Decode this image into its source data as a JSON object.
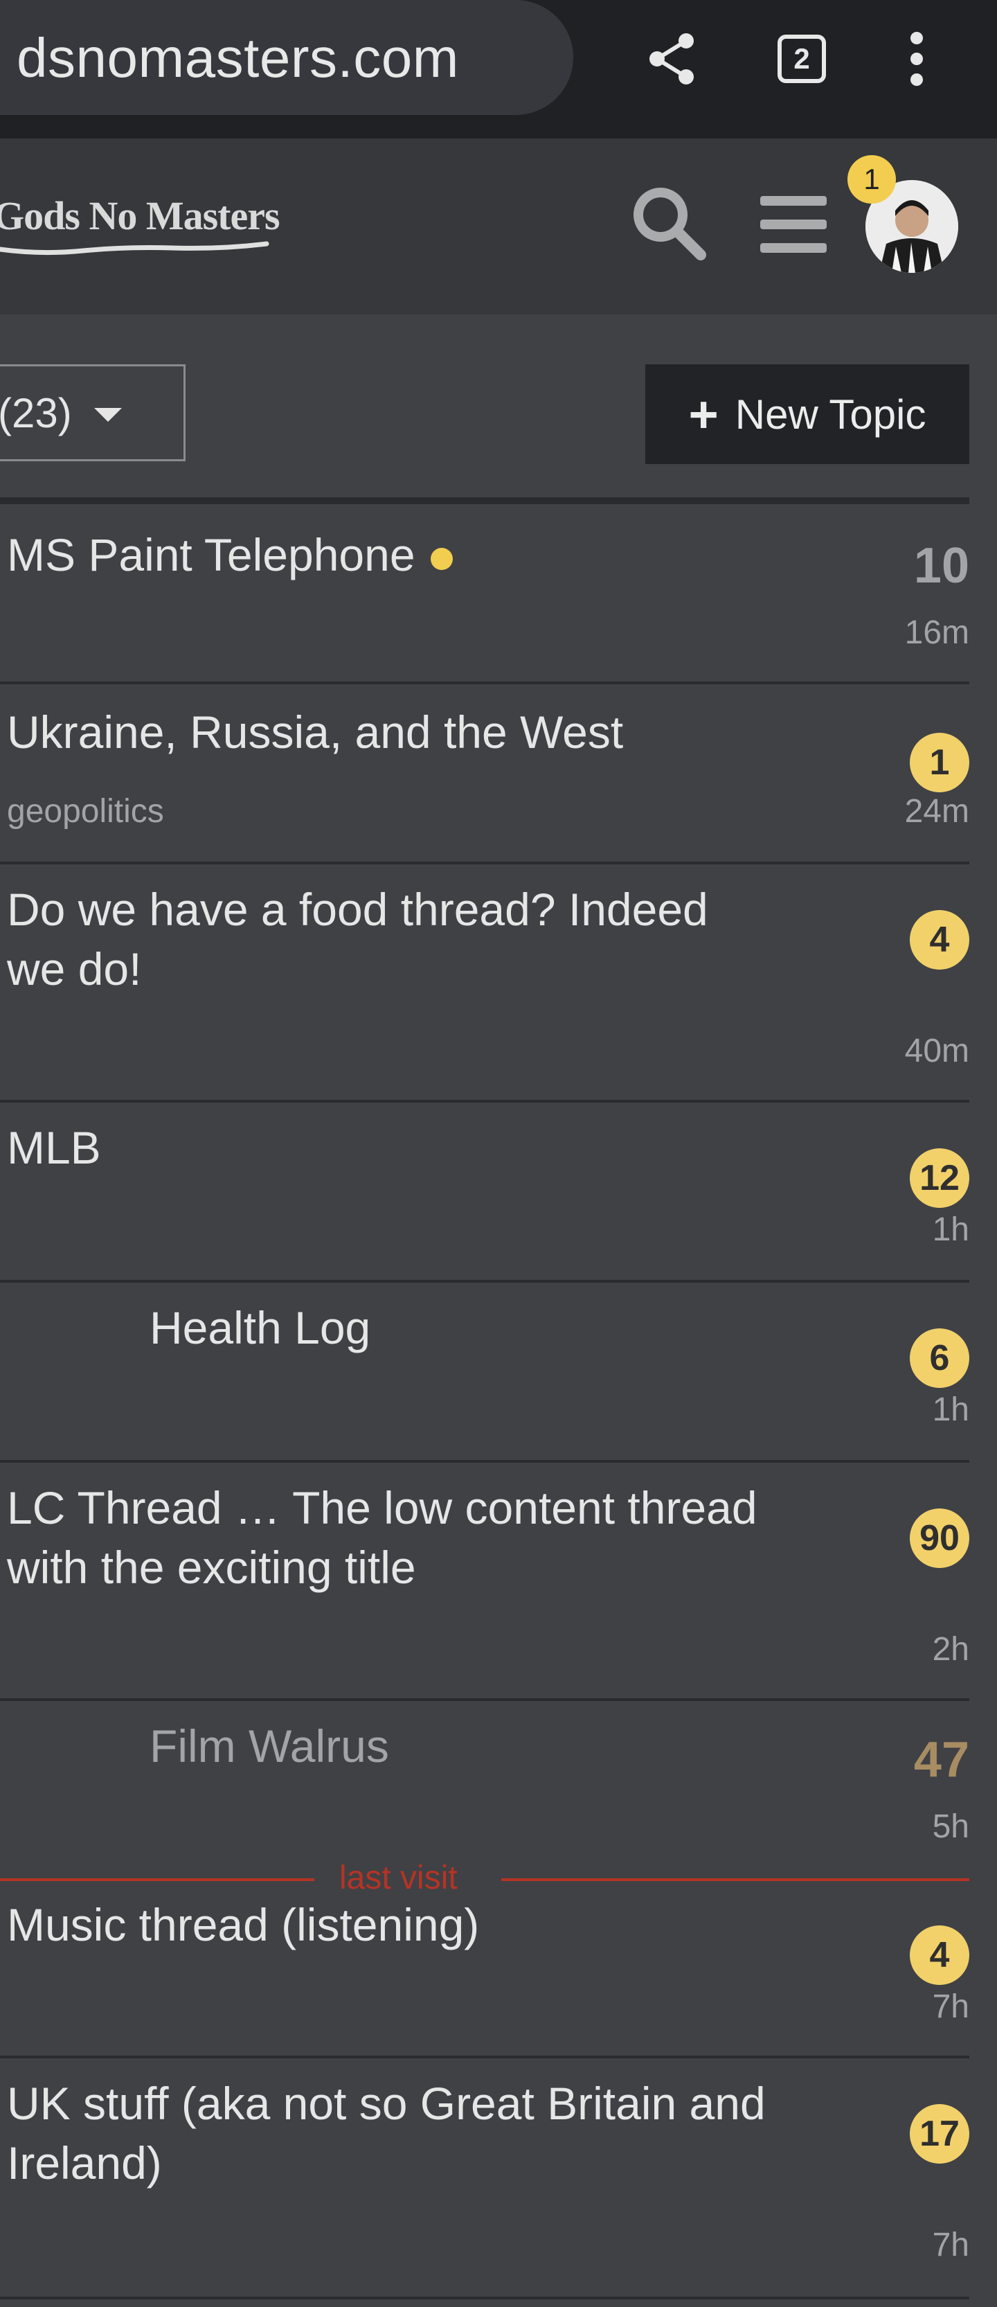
{
  "browser": {
    "url": "dsnomasters.com",
    "tab_count": "2"
  },
  "site": {
    "logo_text": "Gods No Masters",
    "notification_count": "1"
  },
  "controls": {
    "filter_label": "(23)",
    "new_topic_label": "New Topic"
  },
  "last_visit_label": "last visit",
  "topics": [
    {
      "title": "MS Paint Telephone",
      "category": "",
      "count": "10",
      "age": "16m",
      "unread_dot": true
    },
    {
      "title": "Ukraine, Russia, and the West",
      "category": "geopolitics",
      "count": "1",
      "age": "24m"
    },
    {
      "title": "Do we have a food thread? Indeed we do!",
      "category": "",
      "count": "4",
      "age": "40m"
    },
    {
      "title": "MLB",
      "category": "",
      "count": "12",
      "age": "1h"
    },
    {
      "title": "Health Log",
      "category": "",
      "count": "6",
      "age": "1h"
    },
    {
      "title": "LC Thread … The low content thread with the exciting title",
      "category": "",
      "count": "90",
      "age": "2h"
    },
    {
      "title": "Film Walrus",
      "category": "",
      "count": "47",
      "age": "5h"
    },
    {
      "title": "Music thread (listening)",
      "category": "",
      "count": "4",
      "age": "7h"
    },
    {
      "title": "UK stuff (aka not so Great Britain and Ireland)",
      "category": "",
      "count": "17",
      "age": "7h"
    }
  ],
  "colors": {
    "badge": "#f2d16a",
    "last_visit": "#b63324",
    "background": "#3f4145"
  },
  "icons": [
    "lock-icon",
    "share-icon",
    "more-vert-icon",
    "search-icon",
    "hamburger-menu-icon",
    "plus-icon",
    "caret-down-icon"
  ]
}
